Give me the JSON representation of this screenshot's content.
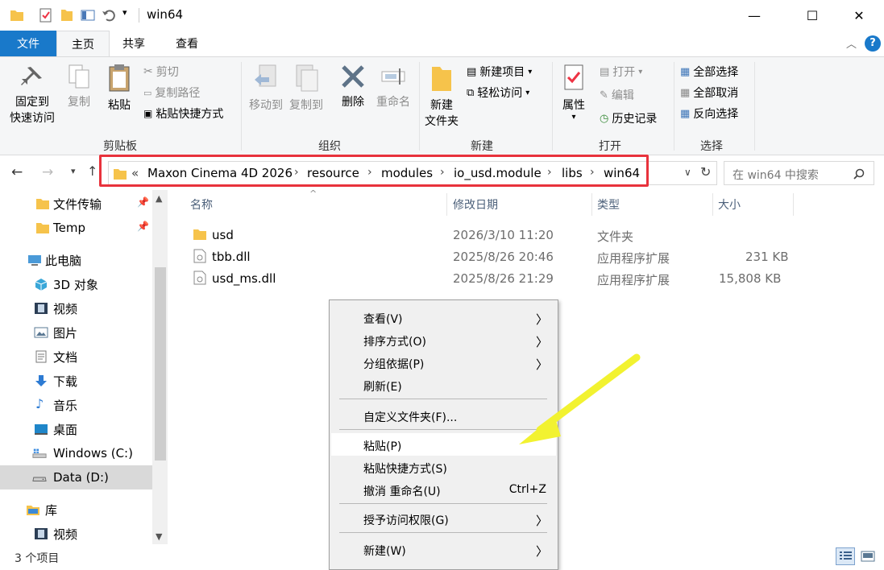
{
  "window": {
    "title": "win64",
    "controls": {
      "minimize": "—",
      "maximize": "☐",
      "close": "✕"
    }
  },
  "ribbon_tabs": [
    "文件",
    "主页",
    "共享",
    "查看"
  ],
  "ribbon": {
    "clipboard": {
      "pin_line1": "固定到",
      "pin_line2": "快速访问",
      "copy": "复制",
      "paste": "粘贴",
      "cut": "剪切",
      "copy_path": "复制路径",
      "paste_shortcut": "粘贴快捷方式",
      "group": "剪贴板"
    },
    "organize": {
      "move_to": "移动到",
      "copy_to": "复制到",
      "delete": "删除",
      "rename": "重命名",
      "group": "组织"
    },
    "new": {
      "new_folder_line1": "新建",
      "new_folder_line2": "文件夹",
      "new_item": "新建项目",
      "easy_access": "轻松访问",
      "group": "新建"
    },
    "open": {
      "properties": "属性",
      "open": "打开",
      "edit": "编辑",
      "history": "历史记录",
      "group": "打开"
    },
    "select": {
      "select_all": "全部选择",
      "select_none": "全部取消",
      "invert": "反向选择",
      "group": "选择"
    }
  },
  "address": {
    "overflow": "«",
    "crumbs": [
      "Maxon Cinema 4D 2026",
      "resource",
      "modules",
      "io_usd.module",
      "libs",
      "win64"
    ],
    "sep": "›",
    "search_placeholder": "在 win64 中搜索"
  },
  "sidebar": {
    "items": [
      {
        "label": "文件传输",
        "pinned": true
      },
      {
        "label": "Temp",
        "pinned": true
      },
      {
        "label": "此电脑"
      },
      {
        "label": "3D 对象"
      },
      {
        "label": "视频"
      },
      {
        "label": "图片"
      },
      {
        "label": "文档"
      },
      {
        "label": "下载"
      },
      {
        "label": "音乐"
      },
      {
        "label": "桌面"
      },
      {
        "label": "Windows (C:)"
      },
      {
        "label": "Data (D:)"
      },
      {
        "label": "库"
      },
      {
        "label": "视频"
      }
    ]
  },
  "filelist": {
    "columns": {
      "name": "名称",
      "date": "修改日期",
      "type": "类型",
      "size": "大小"
    },
    "rows": [
      {
        "name": "usd",
        "date": "2026/3/10 11:20",
        "type": "文件夹",
        "size": ""
      },
      {
        "name": "tbb.dll",
        "date": "2025/8/26 20:46",
        "type": "应用程序扩展",
        "size": "231 KB"
      },
      {
        "name": "usd_ms.dll",
        "date": "2025/8/26 21:29",
        "type": "应用程序扩展",
        "size": "15,808 KB"
      }
    ]
  },
  "status": {
    "count": "3 个项目"
  },
  "context_menu": {
    "view": "查看(V)",
    "sort": "排序方式(O)",
    "group": "分组依据(P)",
    "refresh": "刷新(E)",
    "customize": "自定义文件夹(F)...",
    "paste": "粘贴(P)",
    "paste_shortcut": "粘贴快捷方式(S)",
    "undo": "撤消 重命名(U)",
    "undo_shortcut": "Ctrl+Z",
    "grant_access": "授予访问权限(G)",
    "new": "新建(W)"
  },
  "colors": {
    "accent": "#1979ca",
    "highlight_box": "#e8323c",
    "arrow": "#f2f230",
    "folder": "#f6c34b"
  }
}
